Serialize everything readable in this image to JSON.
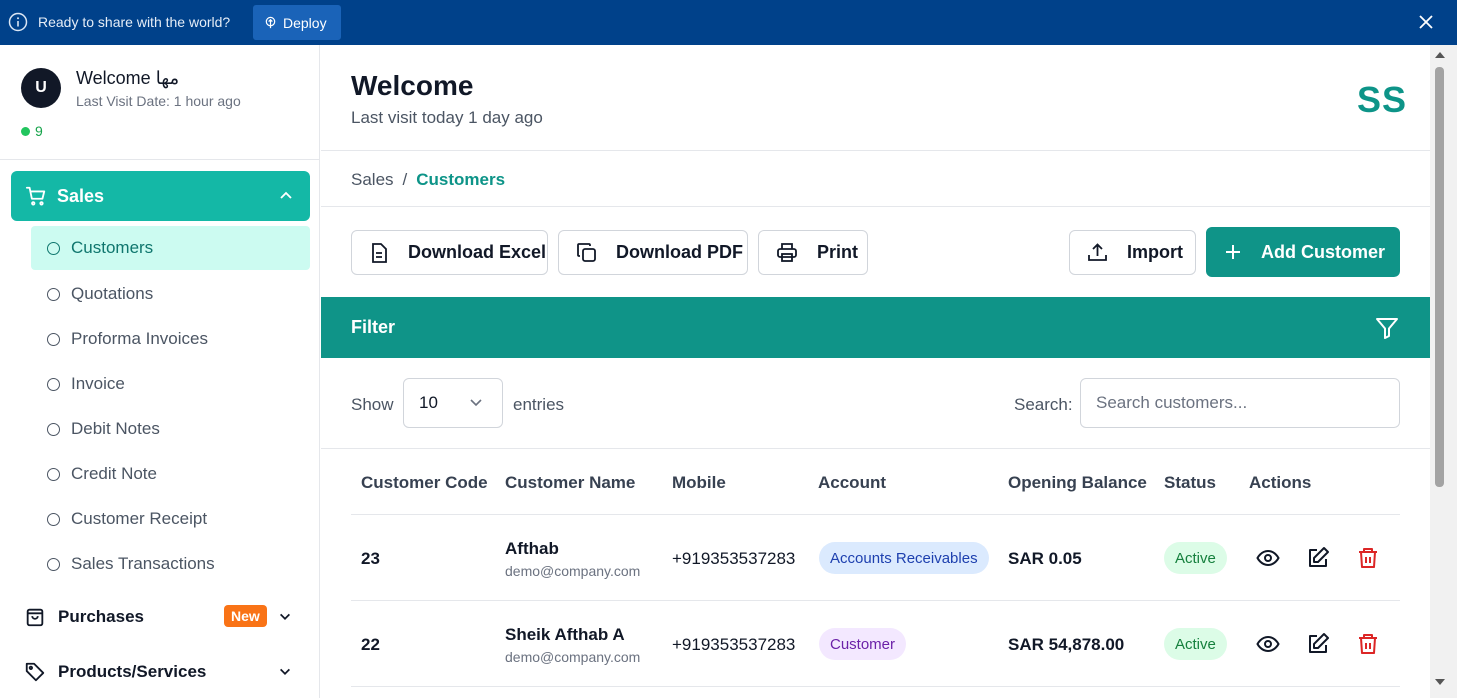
{
  "banner": {
    "message": "Ready to share with the world?",
    "deploy_label": "Deploy"
  },
  "user": {
    "avatar_letter": "U",
    "greeting": "Welcome مها",
    "last_visit": "Last Visit Date: 1 hour ago",
    "online_count": "9"
  },
  "sidebar": {
    "sales_label": "Sales",
    "items": [
      {
        "label": "Customers"
      },
      {
        "label": "Quotations"
      },
      {
        "label": "Proforma Invoices"
      },
      {
        "label": "Invoice"
      },
      {
        "label": "Debit Notes"
      },
      {
        "label": "Credit Note"
      },
      {
        "label": "Customer Receipt"
      },
      {
        "label": "Sales Transactions"
      }
    ],
    "purchases_label": "Purchases",
    "new_badge": "New",
    "products_label": "Products/Services"
  },
  "header": {
    "title": "Welcome",
    "subtitle": "Last visit today 1 day ago",
    "logo": "SS"
  },
  "breadcrumb": {
    "root": "Sales",
    "separator": "/",
    "current": "Customers"
  },
  "toolbar": {
    "download_excel": "Download Excel",
    "download_pdf": "Download PDF",
    "print": "Print",
    "import": "Import",
    "add_customer": "Add Customer"
  },
  "filter": {
    "label": "Filter"
  },
  "table_controls": {
    "show_label": "Show",
    "entries_value": "10",
    "entries_label": "entries",
    "search_label": "Search:",
    "search_placeholder": "Search customers..."
  },
  "table": {
    "columns": [
      "Customer Code",
      "Customer Name",
      "Mobile",
      "Account",
      "Opening Balance",
      "Status",
      "Actions"
    ],
    "rows": [
      {
        "code": "23",
        "name": "Afthab",
        "email": "demo@company.com",
        "mobile": "+919353537283",
        "account": "Accounts Receivables",
        "balance": "SAR 0.05",
        "status": "Active"
      },
      {
        "code": "22",
        "name": "Sheik Afthab A",
        "email": "demo@company.com",
        "mobile": "+919353537283",
        "account": "Customer",
        "balance": "SAR 54,878.00",
        "status": "Active"
      }
    ]
  },
  "colors": {
    "banner_bg": "#00418a",
    "accent": "#0f9488",
    "sidebar_active": "#14b8a6",
    "new_badge": "#f97316",
    "delete": "#dc2626"
  }
}
